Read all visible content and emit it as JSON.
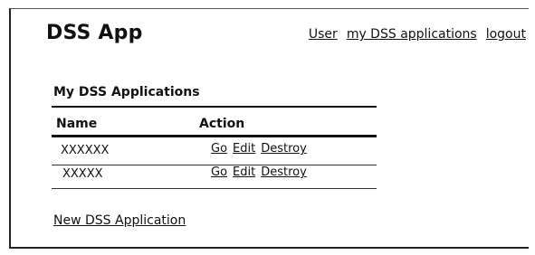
{
  "header": {
    "app_title": "DSS App",
    "links": {
      "user": "User",
      "my_apps": "my DSS applications",
      "logout": "logout"
    }
  },
  "main": {
    "section_title": "My DSS Applications",
    "table": {
      "columns": [
        "Name",
        "Action"
      ],
      "rows": [
        {
          "name": "XXXXXX",
          "actions": [
            "Go",
            "Edit",
            "Destroy"
          ]
        },
        {
          "name": "XXXXX",
          "actions": [
            "Go",
            "Edit",
            "Destroy"
          ]
        }
      ]
    },
    "new_link": "New DSS Application"
  }
}
